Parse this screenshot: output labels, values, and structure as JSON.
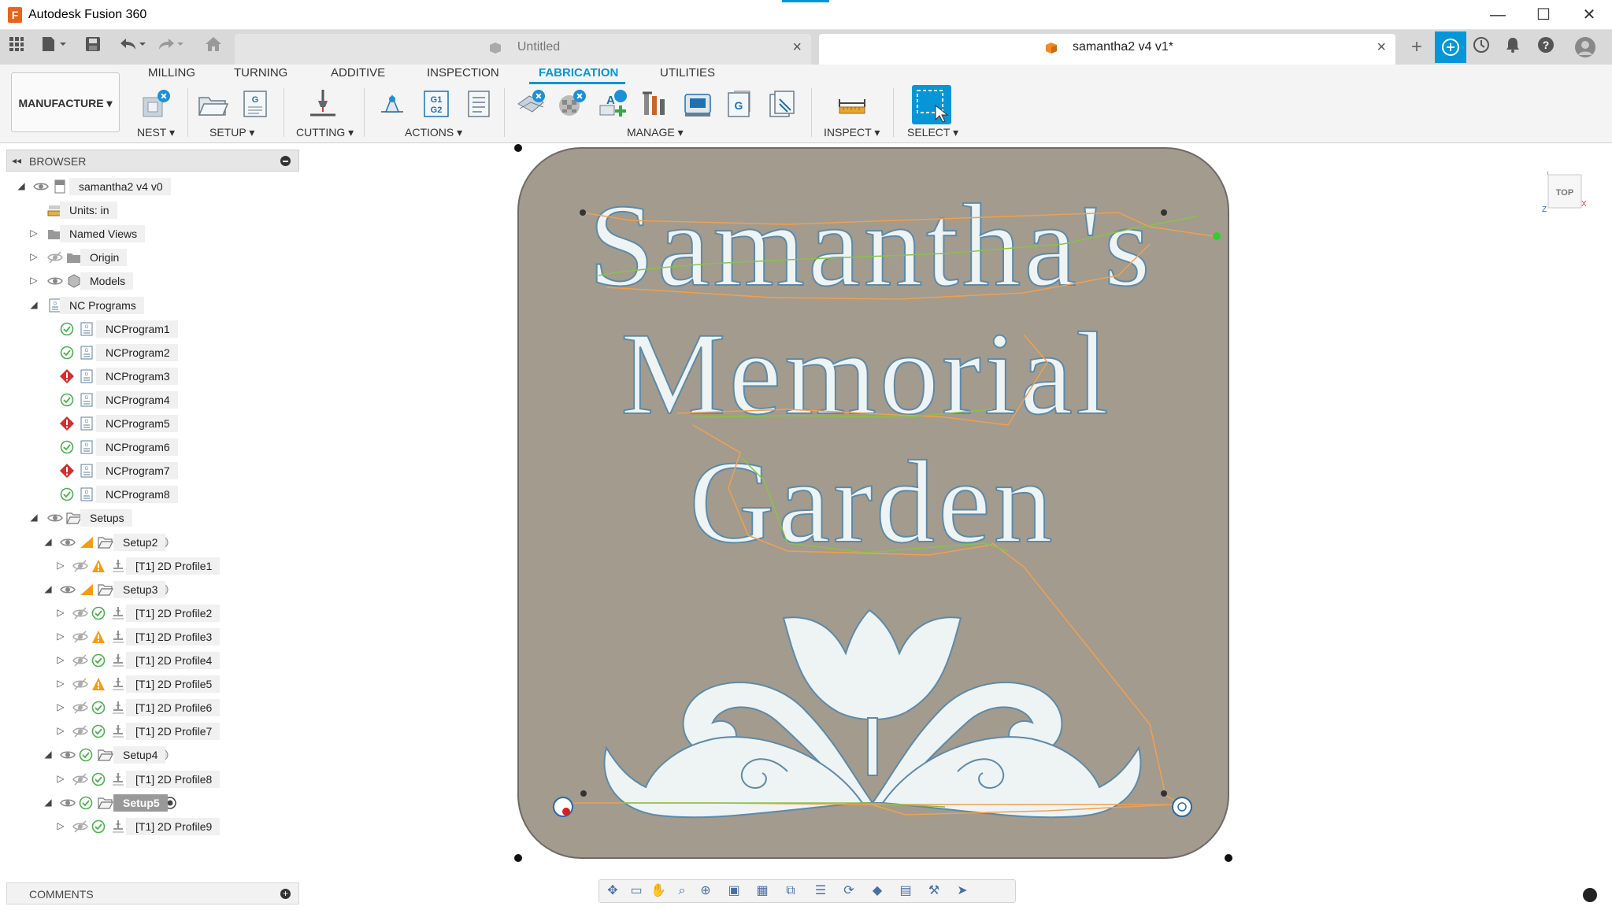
{
  "window": {
    "title": "Autodesk Fusion 360",
    "app_icon": "F",
    "controls": {
      "minimize": "—",
      "maximize": "☐",
      "close": "✕"
    }
  },
  "tabs": [
    {
      "label": "Untitled",
      "active": false
    },
    {
      "label": "samantha2 v4 v1*",
      "active": true
    }
  ],
  "ribbon": {
    "workspace": "MANUFACTURE ▾",
    "tabs": [
      "MILLING",
      "TURNING",
      "ADDITIVE",
      "INSPECTION",
      "FABRICATION",
      "UTILITIES"
    ],
    "active_tab": "FABRICATION",
    "groups": {
      "nest": "NEST ▾",
      "setup": "SETUP ▾",
      "cutting": "CUTTING ▾",
      "actions": "ACTIONS ▾",
      "manage": "MANAGE ▾",
      "inspect": "INSPECT ▾",
      "select": "SELECT ▾"
    },
    "icon_texts": {
      "g1g2": "G1\nG2",
      "g": "G"
    }
  },
  "browser": {
    "title": "BROWSER",
    "root": "samantha2 v4 v0",
    "units": "Units: in",
    "named_views": "Named Views",
    "origin": "Origin",
    "models": "Models",
    "nc_programs": "NC Programs",
    "programs": [
      {
        "label": "NCProgram1",
        "status": "ok"
      },
      {
        "label": "NCProgram2",
        "status": "ok"
      },
      {
        "label": "NCProgram3",
        "status": "error"
      },
      {
        "label": "NCProgram4",
        "status": "ok"
      },
      {
        "label": "NCProgram5",
        "status": "error"
      },
      {
        "label": "NCProgram6",
        "status": "ok"
      },
      {
        "label": "NCProgram7",
        "status": "error"
      },
      {
        "label": "NCProgram8",
        "status": "ok"
      }
    ],
    "setups_label": "Setups",
    "setups": [
      {
        "label": "Setup2",
        "status": "warning",
        "ops": [
          {
            "label": "[T1] 2D Profile1",
            "status": "warning"
          }
        ]
      },
      {
        "label": "Setup3",
        "status": "warning",
        "ops": [
          {
            "label": "[T1] 2D Profile2",
            "status": "ok"
          },
          {
            "label": "[T1] 2D Profile3",
            "status": "warning"
          },
          {
            "label": "[T1] 2D Profile4",
            "status": "ok"
          },
          {
            "label": "[T1] 2D Profile5",
            "status": "warning"
          },
          {
            "label": "[T1] 2D Profile6",
            "status": "ok"
          },
          {
            "label": "[T1] 2D Profile7",
            "status": "ok"
          }
        ]
      },
      {
        "label": "Setup4",
        "status": "ok",
        "ops": [
          {
            "label": "[T1] 2D Profile8",
            "status": "ok"
          }
        ]
      },
      {
        "label": "Setup5",
        "status": "ok",
        "selected": true,
        "ops": [
          {
            "label": "[T1] 2D Profile9",
            "status": "ok"
          }
        ]
      }
    ]
  },
  "comments": {
    "title": "COMMENTS"
  },
  "viewcube": {
    "face": "TOP",
    "axis_x": "X",
    "axis_y": "Y",
    "axis_z": "Z"
  },
  "sign": {
    "line1": "Samantha's",
    "line2": "Memorial",
    "line3": "Garden"
  },
  "colors": {
    "accent": "#0696d7",
    "plate": "#a39b8e",
    "engrave": "#eef3f4",
    "toolpath_orange": "#f0a050",
    "toolpath_green": "#88c24a",
    "ok": "#4caf50",
    "warning": "#f39c12",
    "error": "#d32f2f"
  }
}
